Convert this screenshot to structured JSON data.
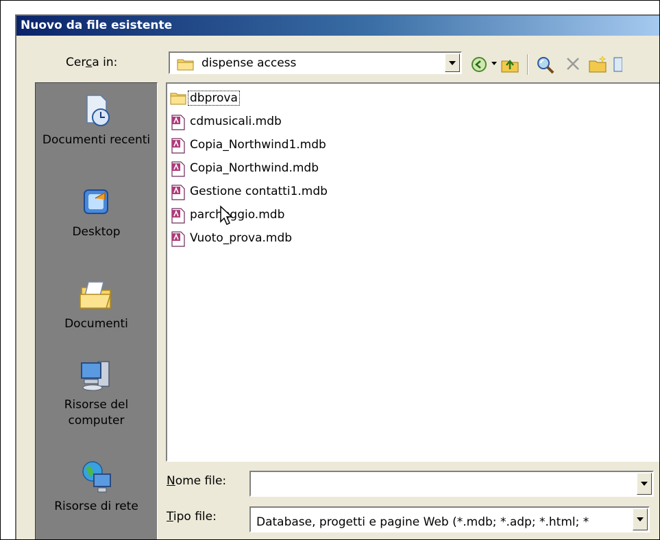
{
  "dialog": {
    "title": "Nuovo da file esistente"
  },
  "lookin": {
    "label_pre": "Cer",
    "label_key": "c",
    "label_post": "a in:",
    "folder": "dispense access"
  },
  "toolbar": {
    "icons": [
      "back-icon",
      "up-folder-icon",
      "search-web-icon",
      "delete-icon",
      "new-folder-icon"
    ]
  },
  "places": [
    {
      "label": "Documenti recenti",
      "icon": "recent-documents-icon"
    },
    {
      "label": "Desktop",
      "icon": "desktop-icon"
    },
    {
      "label": "Documenti",
      "icon": "my-documents-icon"
    },
    {
      "label": "Risorse del computer",
      "icon": "my-computer-icon"
    },
    {
      "label": "Risorse di rete",
      "icon": "network-places-icon"
    }
  ],
  "files": [
    {
      "name": "dbprova",
      "type": "folder"
    },
    {
      "name": "cdmusicali.mdb",
      "type": "mdb"
    },
    {
      "name": "Copia_Northwind1.mdb",
      "type": "mdb"
    },
    {
      "name": "Copia_Northwind.mdb",
      "type": "mdb"
    },
    {
      "name": "Gestione contatti1.mdb",
      "type": "mdb"
    },
    {
      "name": "parcheggio.mdb",
      "type": "mdb"
    },
    {
      "name": "Vuoto_prova.mdb",
      "type": "mdb"
    }
  ],
  "filename": {
    "label_key": "N",
    "label_post": "ome file:",
    "value": ""
  },
  "filetype": {
    "label_key": "T",
    "label_post": "ipo file:",
    "value": "Database, progetti e pagine Web (*.mdb; *.adp; *.html; *"
  },
  "colors": {
    "title_start": "#0a246a",
    "title_end": "#a6caf0",
    "dialog_bg": "#ece9d8",
    "places_bg": "#808080"
  }
}
